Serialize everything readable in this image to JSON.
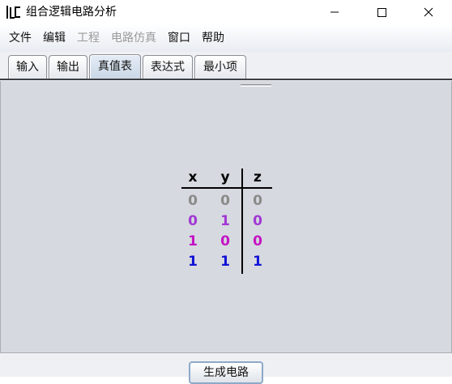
{
  "window": {
    "title": "组合逻辑电路分析",
    "minimize_icon": "minimize-icon",
    "maximize_icon": "maximize-icon",
    "close_icon": "close-icon"
  },
  "menu": [
    {
      "label": "文件",
      "enabled": true
    },
    {
      "label": "编辑",
      "enabled": true
    },
    {
      "label": "工程",
      "enabled": false
    },
    {
      "label": "电路仿真",
      "enabled": false
    },
    {
      "label": "窗口",
      "enabled": true
    },
    {
      "label": "帮助",
      "enabled": true
    }
  ],
  "tabs": [
    {
      "label": "输入",
      "active": false
    },
    {
      "label": "输出",
      "active": false
    },
    {
      "label": "真值表",
      "active": true
    },
    {
      "label": "表达式",
      "active": false
    },
    {
      "label": "最小项",
      "active": false
    }
  ],
  "truth_table": {
    "headers": [
      "x",
      "y",
      "z"
    ],
    "rows": [
      {
        "values": [
          "0",
          "0",
          "0"
        ],
        "color": "#8a8a8a"
      },
      {
        "values": [
          "0",
          "1",
          "0"
        ],
        "color": "#a238d4"
      },
      {
        "values": [
          "1",
          "0",
          "0"
        ],
        "color": "#c414c4"
      },
      {
        "values": [
          "1",
          "1",
          "1"
        ],
        "color": "#1212d6"
      }
    ]
  },
  "bottom": {
    "generate_label": "生成电路"
  }
}
